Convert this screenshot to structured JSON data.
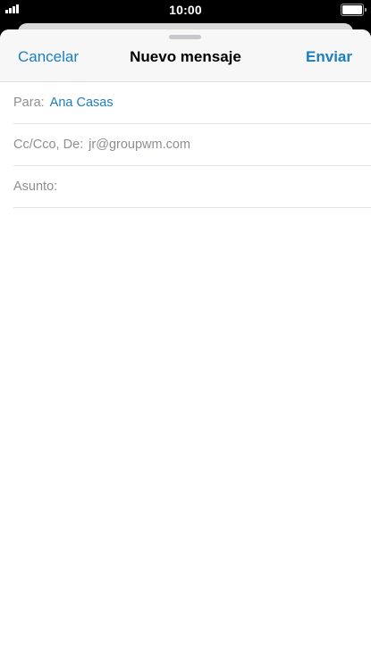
{
  "status_bar": {
    "time": "10:00"
  },
  "compose": {
    "cancel_label": "Cancelar",
    "title": "Nuevo mensaje",
    "send_label": "Enviar",
    "to": {
      "label": "Para:",
      "recipient": "Ana Casas"
    },
    "cc": {
      "label": "Cc/Cco, De:",
      "value": "jr@groupwm.com"
    },
    "subject": {
      "label": "Asunto:",
      "value": ""
    }
  },
  "colors": {
    "accent": "#1a7fc1",
    "label_gray": "#8e8e93",
    "nav_background": "#f7f7f7"
  }
}
